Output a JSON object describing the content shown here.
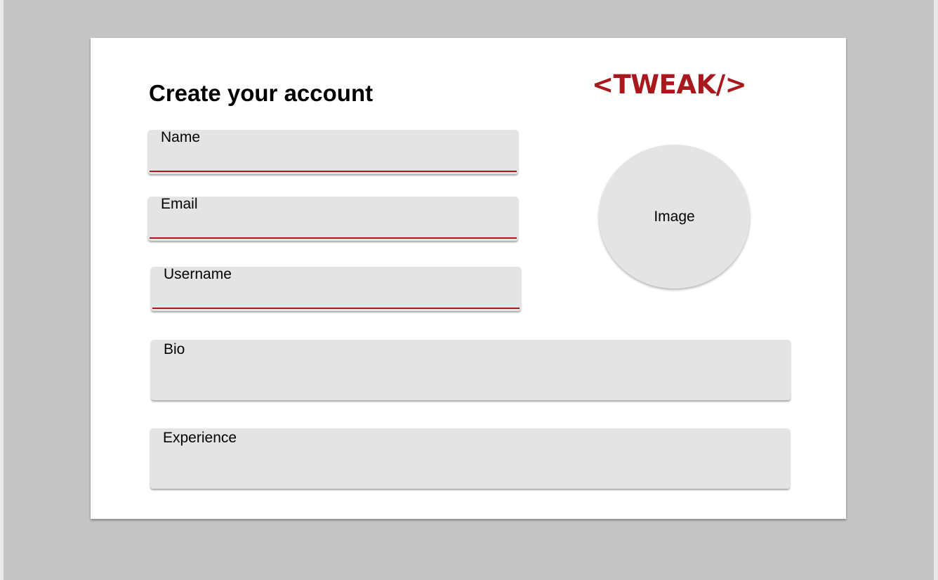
{
  "page": {
    "title": "Create your account",
    "logo_text": "<TWEAK/>",
    "accent_color": "#a8181d"
  },
  "form": {
    "fields": [
      {
        "label": "Name",
        "value": ""
      },
      {
        "label": "Email",
        "value": ""
      },
      {
        "label": "Username",
        "value": ""
      },
      {
        "label": "Bio",
        "value": ""
      },
      {
        "label": "Experience",
        "value": ""
      }
    ]
  },
  "image_upload": {
    "label": "Image"
  }
}
